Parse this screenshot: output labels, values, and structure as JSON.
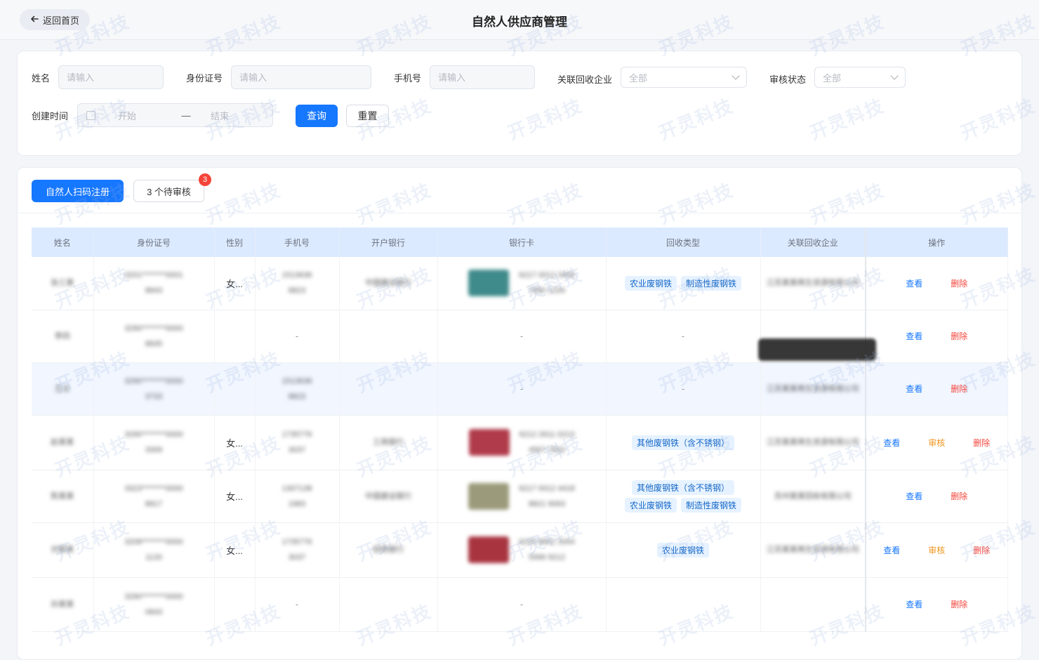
{
  "header": {
    "back_label": "返回首页",
    "title": "自然人供应商管理"
  },
  "filters": {
    "name_label": "姓名",
    "name_placeholder": "请输入",
    "idcard_label": "身份证号",
    "idcard_placeholder": "请输入",
    "phone_label": "手机号",
    "phone_placeholder": "请输入",
    "company_label": "关联回收企业",
    "company_value": "全部",
    "status_label": "审核状态",
    "status_value": "全部",
    "created_label": "创建时间",
    "date_start": "开始",
    "date_sep": "—",
    "date_end": "结束",
    "query_label": "查询",
    "reset_label": "重置"
  },
  "toolbar": {
    "register_label": "自然人扫码注册",
    "pending_label": "3 个待审核",
    "pending_count": "3"
  },
  "table": {
    "columns": [
      "姓名",
      "身份证号",
      "性别",
      "手机号",
      "开户银行",
      "银行卡",
      "回收类型",
      "关联回收企业",
      "操作"
    ],
    "rows": [
      {
        "name": "张三某",
        "id": "3201********0001\n8843",
        "gender": "女...",
        "phone": "1513636\n8823",
        "bank": "中国建设银行",
        "card_img": "#3f8a8a",
        "card": "6217 0012 3456\n7890 1234",
        "types": [
          "农业废钢铁",
          "制造性废钢铁"
        ],
        "company": "江苏某某再生资源有限公司",
        "actions": [
          "查看",
          "删除"
        ],
        "highlight": false
      },
      {
        "name": "李四",
        "id": "3290********0000\n8835",
        "gender": "",
        "phone": "-",
        "bank": "",
        "card_img": "",
        "card": "-",
        "types": [],
        "company": "",
        "actions": [
          "查看",
          "删除"
        ],
        "highlight": false
      },
      {
        "name": "王五",
        "id": "3290********0000\n3733",
        "gender": "",
        "phone": "1513636\n8823",
        "bank": "",
        "card_img": "",
        "card": "-",
        "types": [],
        "company": "江苏某某再生资源有限公司",
        "actions": [
          "查看",
          "删除"
        ],
        "highlight": true
      },
      {
        "name": "赵某某",
        "id": "3290********0000\n3309",
        "gender": "女...",
        "phone": "1735776\n3037",
        "bank": "工商银行",
        "card_img": "#b03b4a",
        "card": "6212 2611 0213\n4567 7832",
        "types": [
          "其他废钢铁（含不锈钢）"
        ],
        "company": "江苏某某再生资源有限公司",
        "actions": [
          "查看",
          "审核",
          "删除"
        ],
        "highlight": false
      },
      {
        "name": "陈某某",
        "id": "3323********0000\n8817",
        "gender": "女...",
        "phone": "1307138\n1983",
        "bank": "中国建设银行",
        "card_img": "#9b9a7a",
        "card": "6217 0012 4418\n8821 9063",
        "types": [
          "其他废钢铁（含不锈钢）",
          "农业废钢铁",
          "制造性废钢铁"
        ],
        "company": "苏州某某回收有限公司",
        "actions": [
          "查看",
          "删除"
        ],
        "highlight": false
      },
      {
        "name": "刘某某",
        "id": "3208********0000\n1133",
        "gender": "女...",
        "phone": "1735776\n3037",
        "bank": "招商银行",
        "card_img": "#a8343f",
        "card": "6225 8801 3344\n5566 9212",
        "types": [
          "农业废钢铁"
        ],
        "company": "江苏某某再生资源有限公司",
        "actions": [
          "查看",
          "审核",
          "删除"
        ],
        "highlight": false
      },
      {
        "name": "孙某某",
        "id": "3290********0000\n0843",
        "gender": "",
        "phone": "-",
        "bank": "",
        "card_img": "",
        "card": "-",
        "types": [],
        "company": "",
        "actions": [
          "查看",
          "删除"
        ],
        "highlight": false
      }
    ]
  },
  "watermark_text": "开灵科技",
  "colors": {
    "primary": "#1677ff",
    "danger": "#f5443a",
    "warning": "#f0961e",
    "tag_bg": "#e6f2ff",
    "header_bg": "#dceaff"
  }
}
